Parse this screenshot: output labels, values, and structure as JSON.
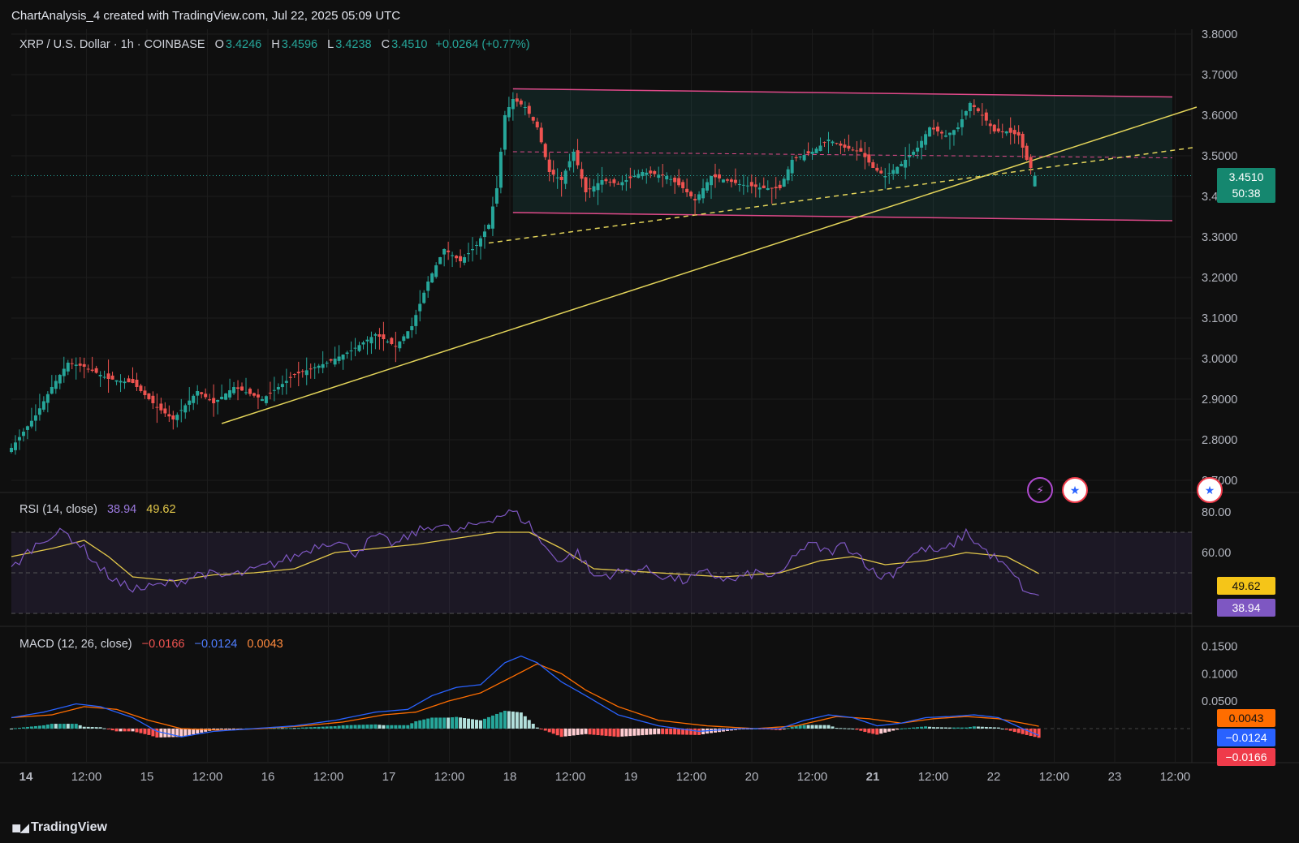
{
  "header": {
    "caption": "ChartAnalysis_4 created with TradingView.com, Jul 22, 2025 05:09 UTC"
  },
  "legend": {
    "symbol": "XRP / U.S. Dollar · 1h · COINBASE",
    "o_label": "O",
    "o": "3.4246",
    "h_label": "H",
    "h": "3.4596",
    "l_label": "L",
    "l": "3.4238",
    "c_label": "C",
    "c": "3.4510",
    "change": "+0.0264 (+0.77%)"
  },
  "rsi_legend": {
    "label": "RSI (14, close)",
    "rsi": "38.94",
    "ma": "49.62"
  },
  "macd_legend": {
    "label": "MACD (12, 26, close)",
    "hist": "−0.0166",
    "macd": "−0.0124",
    "signal": "0.0043"
  },
  "price_badge": {
    "price": "3.4510",
    "countdown": "50:38"
  },
  "rsi_badges": {
    "ma": "49.62",
    "rsi": "38.94"
  },
  "macd_badges": {
    "signal": "0.0043",
    "macd": "−0.0124",
    "hist": "−0.0166"
  },
  "footer": {
    "brand": "TradingView"
  },
  "colors": {
    "up": "#26a69a",
    "down": "#ef5350",
    "channel": "#e04a8a",
    "trend": "#e3d45a",
    "rsi": "#7e57c2",
    "rsi_ma": "#e3c84a",
    "macd": "#2962ff",
    "signal": "#ff6d00"
  },
  "icons": [
    "flash-event-icon",
    "us-flag-event-icon",
    "us-flag-event-icon"
  ],
  "chart_data": {
    "type": "candlestick",
    "symbol": "XRP / U.S. Dollar",
    "interval": "1h",
    "exchange": "COINBASE",
    "x_ticks": [
      "14",
      "12:00",
      "15",
      "12:00",
      "16",
      "12:00",
      "17",
      "12:00",
      "18",
      "12:00",
      "19",
      "12:00",
      "20",
      "12:00",
      "21",
      "12:00",
      "22",
      "12:00",
      "23",
      "12:00"
    ],
    "y_ticks": [
      "3.8000",
      "3.7000",
      "3.6000",
      "3.5000",
      "3.4000",
      "3.3000",
      "3.2000",
      "3.1000",
      "3.0000",
      "2.9000",
      "2.8000",
      "2.7000"
    ],
    "ylim": [
      2.69,
      3.82
    ],
    "price_anchors": [
      [
        0,
        2.78
      ],
      [
        6,
        2.86
      ],
      [
        10,
        2.93
      ],
      [
        14,
        2.99
      ],
      [
        18,
        2.98
      ],
      [
        24,
        2.95
      ],
      [
        30,
        2.94
      ],
      [
        36,
        2.88
      ],
      [
        40,
        2.85
      ],
      [
        46,
        2.92
      ],
      [
        50,
        2.89
      ],
      [
        55,
        2.93
      ],
      [
        62,
        2.9
      ],
      [
        70,
        2.96
      ],
      [
        78,
        2.99
      ],
      [
        84,
        3.02
      ],
      [
        90,
        3.06
      ],
      [
        95,
        3.03
      ],
      [
        99,
        3.08
      ],
      [
        103,
        3.19
      ],
      [
        107,
        3.27
      ],
      [
        111,
        3.24
      ],
      [
        115,
        3.28
      ],
      [
        118,
        3.33
      ],
      [
        120,
        3.42
      ],
      [
        122,
        3.6
      ],
      [
        124,
        3.64
      ],
      [
        127,
        3.62
      ],
      [
        130,
        3.57
      ],
      [
        133,
        3.46
      ],
      [
        136,
        3.44
      ],
      [
        139,
        3.51
      ],
      [
        142,
        3.41
      ],
      [
        146,
        3.44
      ],
      [
        150,
        3.43
      ],
      [
        156,
        3.46
      ],
      [
        162,
        3.45
      ],
      [
        166,
        3.42
      ],
      [
        169,
        3.39
      ],
      [
        173,
        3.45
      ],
      [
        180,
        3.43
      ],
      [
        186,
        3.42
      ],
      [
        190,
        3.42
      ],
      [
        193,
        3.49
      ],
      [
        198,
        3.51
      ],
      [
        202,
        3.54
      ],
      [
        206,
        3.52
      ],
      [
        210,
        3.51
      ],
      [
        213,
        3.47
      ],
      [
        216,
        3.45
      ],
      [
        220,
        3.48
      ],
      [
        224,
        3.52
      ],
      [
        227,
        3.57
      ],
      [
        231,
        3.55
      ],
      [
        234,
        3.57
      ],
      [
        237,
        3.63
      ],
      [
        240,
        3.6
      ],
      [
        243,
        3.56
      ],
      [
        246,
        3.56
      ],
      [
        249,
        3.55
      ],
      [
        251,
        3.49
      ],
      [
        253,
        3.45
      ]
    ],
    "last_candle": {
      "open": 3.4246,
      "high": 3.4596,
      "low": 3.4238,
      "close": 3.451
    },
    "channel": {
      "upper": [
        [
          3.665,
          124
        ],
        [
          3.645,
          287
        ]
      ],
      "lower": [
        [
          3.36,
          124
        ],
        [
          3.34,
          287
        ]
      ],
      "mid": [
        [
          3.51,
          124
        ],
        [
          3.495,
          287
        ]
      ]
    },
    "trendline_solid": [
      [
        2.84,
        52
      ],
      [
        3.62,
        293
      ]
    ],
    "trendline_dashed": [
      [
        3.285,
        118
      ],
      [
        3.52,
        292
      ]
    ],
    "rsi": {
      "period": 14,
      "value": 38.94,
      "ma": 49.62,
      "levels": [
        70,
        50,
        30
      ],
      "ylim": [
        20,
        85
      ],
      "y_ticks": [
        "80.00",
        "60.00"
      ],
      "anchors": [
        [
          0,
          52
        ],
        [
          5,
          62
        ],
        [
          9,
          68
        ],
        [
          13,
          70
        ],
        [
          17,
          64
        ],
        [
          22,
          52
        ],
        [
          27,
          44
        ],
        [
          32,
          42
        ],
        [
          37,
          44
        ],
        [
          42,
          46
        ],
        [
          47,
          50
        ],
        [
          52,
          48
        ],
        [
          58,
          50
        ],
        [
          64,
          54
        ],
        [
          70,
          58
        ],
        [
          76,
          64
        ],
        [
          80,
          66
        ],
        [
          85,
          60
        ],
        [
          90,
          68
        ],
        [
          95,
          64
        ],
        [
          100,
          70
        ],
        [
          105,
          74
        ],
        [
          110,
          70
        ],
        [
          115,
          74
        ],
        [
          120,
          78
        ],
        [
          124,
          80
        ],
        [
          128,
          74
        ],
        [
          132,
          62
        ],
        [
          136,
          56
        ],
        [
          140,
          60
        ],
        [
          144,
          48
        ],
        [
          150,
          50
        ],
        [
          156,
          52
        ],
        [
          162,
          48
        ],
        [
          166,
          46
        ],
        [
          172,
          50
        ],
        [
          178,
          46
        ],
        [
          184,
          50
        ],
        [
          190,
          48
        ],
        [
          194,
          60
        ],
        [
          198,
          64
        ],
        [
          202,
          60
        ],
        [
          206,
          64
        ],
        [
          210,
          58
        ],
        [
          214,
          48
        ],
        [
          218,
          50
        ],
        [
          222,
          58
        ],
        [
          226,
          62
        ],
        [
          230,
          60
        ],
        [
          234,
          66
        ],
        [
          236,
          70
        ],
        [
          240,
          62
        ],
        [
          244,
          56
        ],
        [
          248,
          48
        ],
        [
          252,
          38
        ],
        [
          254,
          38.94
        ]
      ],
      "ma_anchors": [
        [
          0,
          58
        ],
        [
          10,
          62
        ],
        [
          18,
          66
        ],
        [
          24,
          58
        ],
        [
          30,
          48
        ],
        [
          40,
          46
        ],
        [
          50,
          49
        ],
        [
          60,
          50
        ],
        [
          70,
          52
        ],
        [
          80,
          60
        ],
        [
          90,
          62
        ],
        [
          100,
          64
        ],
        [
          110,
          67
        ],
        [
          120,
          70
        ],
        [
          128,
          70
        ],
        [
          136,
          62
        ],
        [
          144,
          52
        ],
        [
          160,
          50
        ],
        [
          176,
          48
        ],
        [
          190,
          50
        ],
        [
          200,
          56
        ],
        [
          208,
          58
        ],
        [
          216,
          54
        ],
        [
          226,
          56
        ],
        [
          236,
          60
        ],
        [
          246,
          58
        ],
        [
          254,
          49.62
        ]
      ]
    },
    "macd": {
      "fast": 12,
      "slow": 26,
      "macd": -0.0124,
      "signal": 0.0043,
      "histogram": -0.0166,
      "ylim": [
        -0.04,
        0.17
      ],
      "y_ticks": [
        "0.1500",
        "0.1000",
        "0.0500"
      ],
      "anchors": [
        [
          0,
          0.02
        ],
        [
          8,
          0.03
        ],
        [
          16,
          0.045
        ],
        [
          22,
          0.04
        ],
        [
          30,
          0.02
        ],
        [
          36,
          -0.005
        ],
        [
          42,
          -0.015
        ],
        [
          50,
          -0.005
        ],
        [
          60,
          0.0
        ],
        [
          70,
          0.005
        ],
        [
          80,
          0.015
        ],
        [
          90,
          0.03
        ],
        [
          98,
          0.035
        ],
        [
          104,
          0.06
        ],
        [
          110,
          0.075
        ],
        [
          116,
          0.08
        ],
        [
          122,
          0.12
        ],
        [
          126,
          0.132
        ],
        [
          130,
          0.12
        ],
        [
          136,
          0.085
        ],
        [
          142,
          0.06
        ],
        [
          150,
          0.025
        ],
        [
          160,
          0.005
        ],
        [
          170,
          -0.005
        ],
        [
          180,
          0.0
        ],
        [
          190,
          0.0
        ],
        [
          196,
          0.015
        ],
        [
          202,
          0.025
        ],
        [
          208,
          0.02
        ],
        [
          214,
          0.005
        ],
        [
          220,
          0.01
        ],
        [
          226,
          0.02
        ],
        [
          232,
          0.022
        ],
        [
          238,
          0.025
        ],
        [
          244,
          0.02
        ],
        [
          250,
          0.0
        ],
        [
          254,
          -0.0124
        ]
      ],
      "signal_anchors": [
        [
          0,
          0.02
        ],
        [
          10,
          0.025
        ],
        [
          18,
          0.04
        ],
        [
          26,
          0.035
        ],
        [
          34,
          0.015
        ],
        [
          42,
          0.0
        ],
        [
          52,
          -0.003
        ],
        [
          62,
          0.0
        ],
        [
          72,
          0.005
        ],
        [
          82,
          0.012
        ],
        [
          92,
          0.025
        ],
        [
          100,
          0.03
        ],
        [
          108,
          0.05
        ],
        [
          116,
          0.065
        ],
        [
          124,
          0.095
        ],
        [
          130,
          0.118
        ],
        [
          136,
          0.1
        ],
        [
          142,
          0.07
        ],
        [
          150,
          0.04
        ],
        [
          160,
          0.015
        ],
        [
          172,
          0.005
        ],
        [
          184,
          0.0
        ],
        [
          194,
          0.005
        ],
        [
          204,
          0.022
        ],
        [
          212,
          0.018
        ],
        [
          220,
          0.01
        ],
        [
          228,
          0.018
        ],
        [
          236,
          0.022
        ],
        [
          244,
          0.018
        ],
        [
          250,
          0.01
        ],
        [
          254,
          0.0043
        ]
      ]
    }
  }
}
